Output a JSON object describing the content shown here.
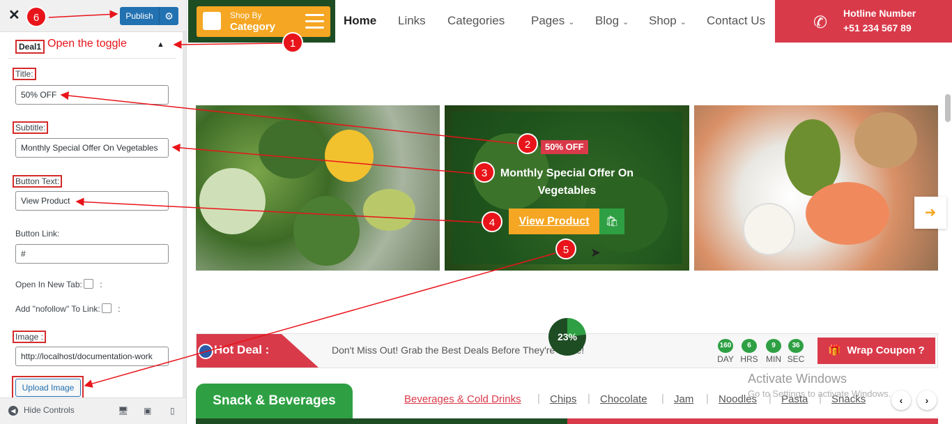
{
  "customizer": {
    "close_icon": "close-icon",
    "publish_label": "Publish",
    "section_label": "Deal1",
    "toggle_icon": "triangle-up-icon",
    "fields": {
      "title_label": "Title:",
      "title_value": "50% OFF",
      "subtitle_label": "Subtitle:",
      "subtitle_value": "Monthly Special Offer On Vegetables",
      "button_text_label": "Button Text:",
      "button_text_value": "View Product",
      "button_link_label": "Button Link:",
      "button_link_value": "#",
      "new_tab_label": "Open In New Tab:",
      "nofollow_label": "Add \"nofollow\" To Link:",
      "colon": ":",
      "image_label": "Image :",
      "image_value": "http://localhost/documentation-work",
      "upload_label": "Upload Image"
    },
    "footer": {
      "hide_controls": "Hide Controls"
    }
  },
  "header": {
    "shop_by": "Shop By",
    "category": "Category",
    "nav": [
      "Home",
      "Links",
      "Categories",
      "Pages",
      "Blog",
      "Shop",
      "Contact Us"
    ],
    "hotline_title": "Hotline Number",
    "hotline_number": "+51 234 567 89"
  },
  "deal_banner": {
    "tag": "50% OFF",
    "subtitle": "Monthly Special Offer On Vegetables",
    "button": "View Product"
  },
  "hot_deal": {
    "label": "Hot Deal :",
    "message": "Don't Miss Out! Grab the Best Deals Before They're Gone!",
    "countdown": [
      {
        "value": "160",
        "unit": "DAY"
      },
      {
        "value": "6",
        "unit": "HRS"
      },
      {
        "value": "9",
        "unit": "MIN"
      },
      {
        "value": "36",
        "unit": "SEC"
      }
    ],
    "coupon": "Wrap Coupon ?",
    "progress_label": "23%",
    "progress": 23
  },
  "categories": {
    "heading": "Snack & Beverages",
    "tabs": [
      "Beverages & Cold Drinks",
      "Chips",
      "Chocolate",
      "Jam",
      "Noodles",
      "Pasta",
      "Snacks"
    ]
  },
  "windows": {
    "line1": "Activate Windows",
    "line2": "Go to Settings to activate Windows."
  },
  "annotations": {
    "open_toggle": "Open the toggle",
    "steps": [
      "1",
      "2",
      "3",
      "4",
      "5",
      "6"
    ]
  },
  "colors": {
    "accent_red": "#d93a4a",
    "dark_green": "#1e4d24",
    "green": "#2ea043",
    "orange": "#f5a623",
    "wp_blue": "#2271b1",
    "annotation_red": "#e8141a"
  }
}
